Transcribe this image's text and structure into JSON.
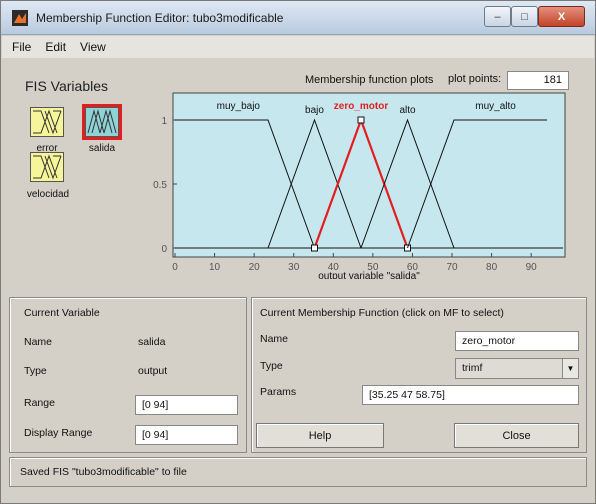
{
  "window": {
    "title": "Membership Function Editor: tubo3modificable",
    "icon": "matlab-icon",
    "controls": {
      "minimize": "–",
      "maximize": "□",
      "close": "X"
    }
  },
  "menu": [
    "File",
    "Edit",
    "View"
  ],
  "fis_variables": {
    "label": "FIS Variables",
    "items": [
      {
        "name": "error",
        "selected": false
      },
      {
        "name": "salida",
        "selected": true
      },
      {
        "name": "velocidad",
        "selected": false
      }
    ]
  },
  "plot": {
    "title": "Membership function plots",
    "plot_points_label": "plot points:",
    "plot_points_value": "181",
    "background_color": "#c6e7ee",
    "selected_color": "#e31e1e",
    "mf_labels": {
      "muy_bajo": "muy_bajo",
      "bajo": "bajo",
      "zero_motor": "zero_motor",
      "alto": "alto",
      "muy_alto": "muy_alto"
    }
  },
  "chart_data": {
    "type": "line",
    "xlabel": "output variable \"salida\"",
    "xlim": [
      0,
      94
    ],
    "ylim": [
      0,
      1
    ],
    "xticks": [
      "0",
      "10",
      "20",
      "30",
      "40",
      "50",
      "60",
      "70",
      "80",
      "90"
    ],
    "yticks": [
      "0",
      "0.5",
      "1"
    ],
    "series": [
      {
        "name": "muy_bajo",
        "x": [
          0,
          23.5,
          35.25
        ],
        "y": [
          1,
          1,
          0
        ]
      },
      {
        "name": "bajo",
        "x": [
          23.5,
          35.25,
          47
        ],
        "y": [
          0,
          1,
          0
        ]
      },
      {
        "name": "zero_motor",
        "x": [
          35.25,
          47,
          58.75
        ],
        "y": [
          0,
          1,
          0
        ],
        "selected": true
      },
      {
        "name": "alto",
        "x": [
          47,
          58.75,
          70.5
        ],
        "y": [
          0,
          1,
          0
        ]
      },
      {
        "name": "muy_alto",
        "x": [
          58.75,
          70.5,
          94
        ],
        "y": [
          0,
          1,
          1
        ]
      }
    ]
  },
  "current_variable": {
    "title": "Current Variable",
    "name_label": "Name",
    "name_value": "salida",
    "type_label": "Type",
    "type_value": "output",
    "range_label": "Range",
    "range_value": "[0 94]",
    "display_range_label": "Display Range",
    "display_range_value": "[0 94]"
  },
  "current_mf": {
    "title": "Current Membership Function (click on MF to select)",
    "name_label": "Name",
    "name_value": "zero_motor",
    "type_label": "Type",
    "type_value": "trimf",
    "params_label": "Params",
    "params_value": "[35.25 47 58.75]",
    "help_label": "Help",
    "close_label": "Close"
  },
  "status": "Saved FIS \"tubo3modificable\" to file"
}
